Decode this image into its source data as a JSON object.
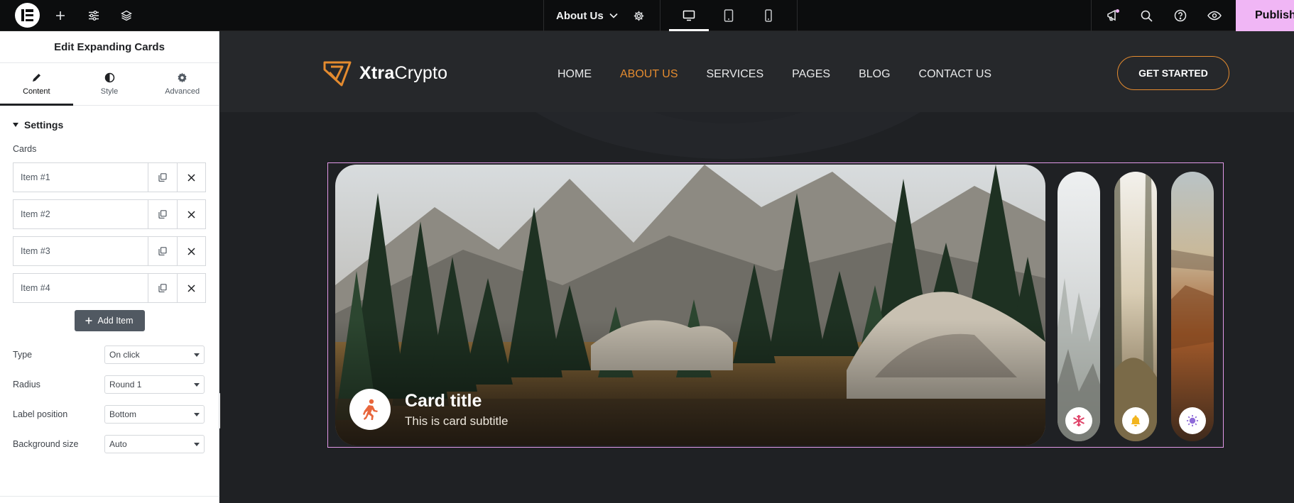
{
  "topbar": {
    "page_name": "About Us",
    "publish_label": "Publish",
    "icons": [
      "elementor-logo-icon",
      "add-icon",
      "sliders-icon",
      "layers-icon",
      "gear-icon",
      "desktop-icon",
      "tablet-icon",
      "mobile-icon",
      "megaphone-icon",
      "search-icon",
      "help-icon",
      "eye-icon"
    ]
  },
  "panel": {
    "title": "Edit Expanding Cards",
    "tabs": [
      {
        "label": "Content",
        "icon": "pencil-icon"
      },
      {
        "label": "Style",
        "icon": "half-circle-icon"
      },
      {
        "label": "Advanced",
        "icon": "gear-icon"
      }
    ],
    "section_title": "Settings",
    "cards_label": "Cards",
    "items": [
      {
        "label": "Item #1"
      },
      {
        "label": "Item #2"
      },
      {
        "label": "Item #3"
      },
      {
        "label": "Item #4"
      }
    ],
    "add_item_label": "Add Item",
    "controls": [
      {
        "label": "Type",
        "value": "On click"
      },
      {
        "label": "Radius",
        "value": "Round 1"
      },
      {
        "label": "Label position",
        "value": "Bottom"
      },
      {
        "label": "Background size",
        "value": "Auto"
      }
    ]
  },
  "site": {
    "brand_bold": "Xtra",
    "brand_light": "Crypto",
    "nav": [
      "HOME",
      "ABOUT US",
      "SERVICES",
      "PAGES",
      "BLOG",
      "CONTACT US"
    ],
    "nav_active_index": 1,
    "cta_label": "GET STARTED",
    "accent_color": "#e48b2f"
  },
  "cards": {
    "active_title": "Card title",
    "active_subtitle": "This is card subtitle",
    "icons": [
      "running-person-icon",
      "snowflake-icon",
      "bell-icon",
      "sun-icon"
    ],
    "icon_colors": [
      "#e8663c",
      "#e0456b",
      "#f2b51f",
      "#8f6bd8"
    ],
    "frame_color": "#e299e8"
  }
}
